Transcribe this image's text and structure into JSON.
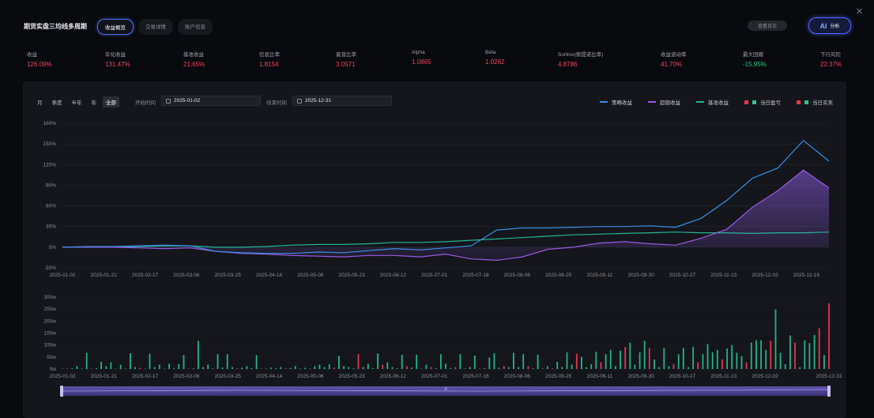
{
  "title": "期货实盘三均线多周期",
  "tabs": [
    {
      "label": "收益概览",
      "active": true
    },
    {
      "label": "交易详情",
      "active": false
    },
    {
      "label": "账户信息",
      "active": false
    }
  ],
  "log_button": "查看日志",
  "ai_button": {
    "mark": "AI",
    "label": "分析"
  },
  "close_icon": "×",
  "stats": [
    {
      "label": "收益",
      "value": "126.09%",
      "color": "red"
    },
    {
      "label": "年化收益",
      "value": "131.47%",
      "color": "red"
    },
    {
      "label": "基准收益",
      "value": "21.65%",
      "color": "red"
    },
    {
      "label": "信息比率",
      "value": "1.8154",
      "color": "red"
    },
    {
      "label": "夏普比率",
      "value": "3.0571",
      "color": "red"
    },
    {
      "label": "Alpha",
      "value": "1.0865",
      "color": "red"
    },
    {
      "label": "Beta",
      "value": "1.0262",
      "color": "red"
    },
    {
      "label": "Sortino(索提诺比率)",
      "value": "4.8786",
      "color": "red"
    },
    {
      "label": "收益波动率",
      "value": "41.70%",
      "color": "red"
    },
    {
      "label": "最大回撤",
      "value": "-15.95%",
      "color": "green"
    },
    {
      "label": "下行风险",
      "value": "22.37%",
      "color": "red"
    }
  ],
  "periods": [
    {
      "label": "月",
      "active": false
    },
    {
      "label": "季度",
      "active": false
    },
    {
      "label": "半年",
      "active": false
    },
    {
      "label": "年",
      "active": false
    },
    {
      "label": "全部",
      "active": true
    }
  ],
  "start": {
    "label": "开始时间",
    "value": "2025-01-02"
  },
  "end": {
    "label": "结束时间",
    "value": "2025-12-31"
  },
  "legend": [
    {
      "label": "策略收益",
      "type": "line",
      "color": "#3a8ee6"
    },
    {
      "label": "超额收益",
      "type": "line",
      "color": "#9b59e6"
    },
    {
      "label": "基准收益",
      "type": "line",
      "color": "#26b596"
    },
    {
      "label": "当日盈亏",
      "type": "box",
      "colors": [
        "#e6344d",
        "#2ec48b"
      ]
    },
    {
      "label": "当日买卖",
      "type": "box",
      "colors": [
        "#e6344d",
        "#2ec48b"
      ]
    }
  ],
  "colors": {
    "strategy": "#3a8ee6",
    "excess": "#9b59e6",
    "benchmark": "#26b596",
    "up": "#e6344d",
    "down": "#22b38a"
  },
  "chart_data": [
    {
      "type": "line",
      "x_ticks": [
        "2025-01-02",
        "2025-01-21",
        "2025-02-17",
        "2025-03-06",
        "2025-03-25",
        "2025-04-14",
        "2025-05-06",
        "2025-05-23",
        "2025-06-12",
        "2025-07-01",
        "2025-07-18",
        "2025-08-06",
        "2025-08-25",
        "2025-09-11",
        "2025-09-30",
        "2025-10-27",
        "2025-11-13",
        "2025-12-02",
        "2025-12-19"
      ],
      "y_ticks": [
        "180%",
        "150%",
        "120%",
        "90%",
        "60%",
        "30%",
        "0%",
        "-30%"
      ],
      "ylim": [
        -30,
        180
      ],
      "series": [
        {
          "name": "策略收益",
          "values": [
            0,
            1,
            1,
            2,
            3,
            2,
            -6,
            -8,
            -9,
            -9,
            -7,
            -8,
            -5,
            -2,
            -4,
            -1,
            2,
            25,
            28,
            28,
            29,
            30,
            30,
            31,
            29,
            42,
            68,
            100,
            115,
            155,
            125
          ]
        },
        {
          "name": "超额收益",
          "values": [
            0,
            0,
            0,
            -1,
            -2,
            -1,
            -6,
            -9,
            -10,
            -12,
            -13,
            -14,
            -12,
            -12,
            -14,
            -10,
            -17,
            -19,
            -14,
            -3,
            0,
            6,
            8,
            5,
            3,
            13,
            26,
            58,
            82,
            112,
            86
          ]
        },
        {
          "name": "基准收益",
          "values": [
            0,
            0,
            0,
            1,
            2,
            2,
            0,
            0,
            1,
            3,
            4,
            4,
            5,
            7,
            7,
            8,
            10,
            12,
            14,
            16,
            18,
            19,
            20,
            21,
            22,
            21,
            21,
            20,
            21,
            21,
            22
          ]
        }
      ]
    },
    {
      "type": "bar",
      "x_ticks": [
        "2025-01-02",
        "2025-01-21",
        "2025-02-17",
        "2025-03-06",
        "2025-03-25",
        "2025-04-14",
        "2025-05-06",
        "2025-05-23",
        "2025-06-12",
        "2025-07-01",
        "2025-07-18",
        "2025-08-06",
        "2025-08-25",
        "2025-09-11",
        "2025-09-30",
        "2025-10-27",
        "2025-11-13",
        "2025-12-02",
        "2025-12-31"
      ],
      "y_ticks": [
        "300w",
        "250w",
        "200w",
        "150w",
        "100w",
        "50w",
        "0w"
      ],
      "ylim": [
        0,
        300
      ],
      "values": [
        2,
        1,
        3,
        12,
        1,
        68,
        2,
        4,
        30,
        12,
        28,
        2,
        18,
        2,
        66,
        8,
        5,
        2,
        64,
        8,
        18,
        2,
        22,
        3,
        20,
        58,
        2,
        3,
        118,
        8,
        18,
        3,
        62,
        6,
        62,
        8,
        3,
        6,
        12,
        4,
        58,
        2,
        2,
        6,
        3,
        8,
        3,
        4,
        12,
        2,
        5,
        3,
        12,
        18,
        8,
        20,
        6,
        55,
        12,
        8,
        3,
        62,
        8,
        22,
        3,
        65,
        18,
        28,
        8,
        3,
        60,
        12,
        6,
        60,
        2,
        18,
        8,
        3,
        62,
        22,
        4,
        8,
        62,
        2,
        8,
        56,
        2,
        3,
        48,
        66,
        5,
        12,
        8,
        68,
        8,
        62,
        12,
        3,
        60,
        2,
        12,
        3,
        30,
        8,
        70,
        18,
        64,
        50,
        8,
        20,
        72,
        28,
        62,
        80,
        12,
        76,
        92,
        110,
        18,
        70,
        118,
        88,
        40,
        8,
        88,
        12,
        20,
        62,
        88,
        8,
        92,
        28,
        62,
        104,
        70,
        80,
        40,
        86,
        100,
        68,
        54,
        28,
        110,
        120,
        120,
        80,
        118,
        248,
        68,
        20,
        140,
        110,
        8,
        120,
        108,
        142,
        170,
        58,
        274
      ]
    }
  ]
}
